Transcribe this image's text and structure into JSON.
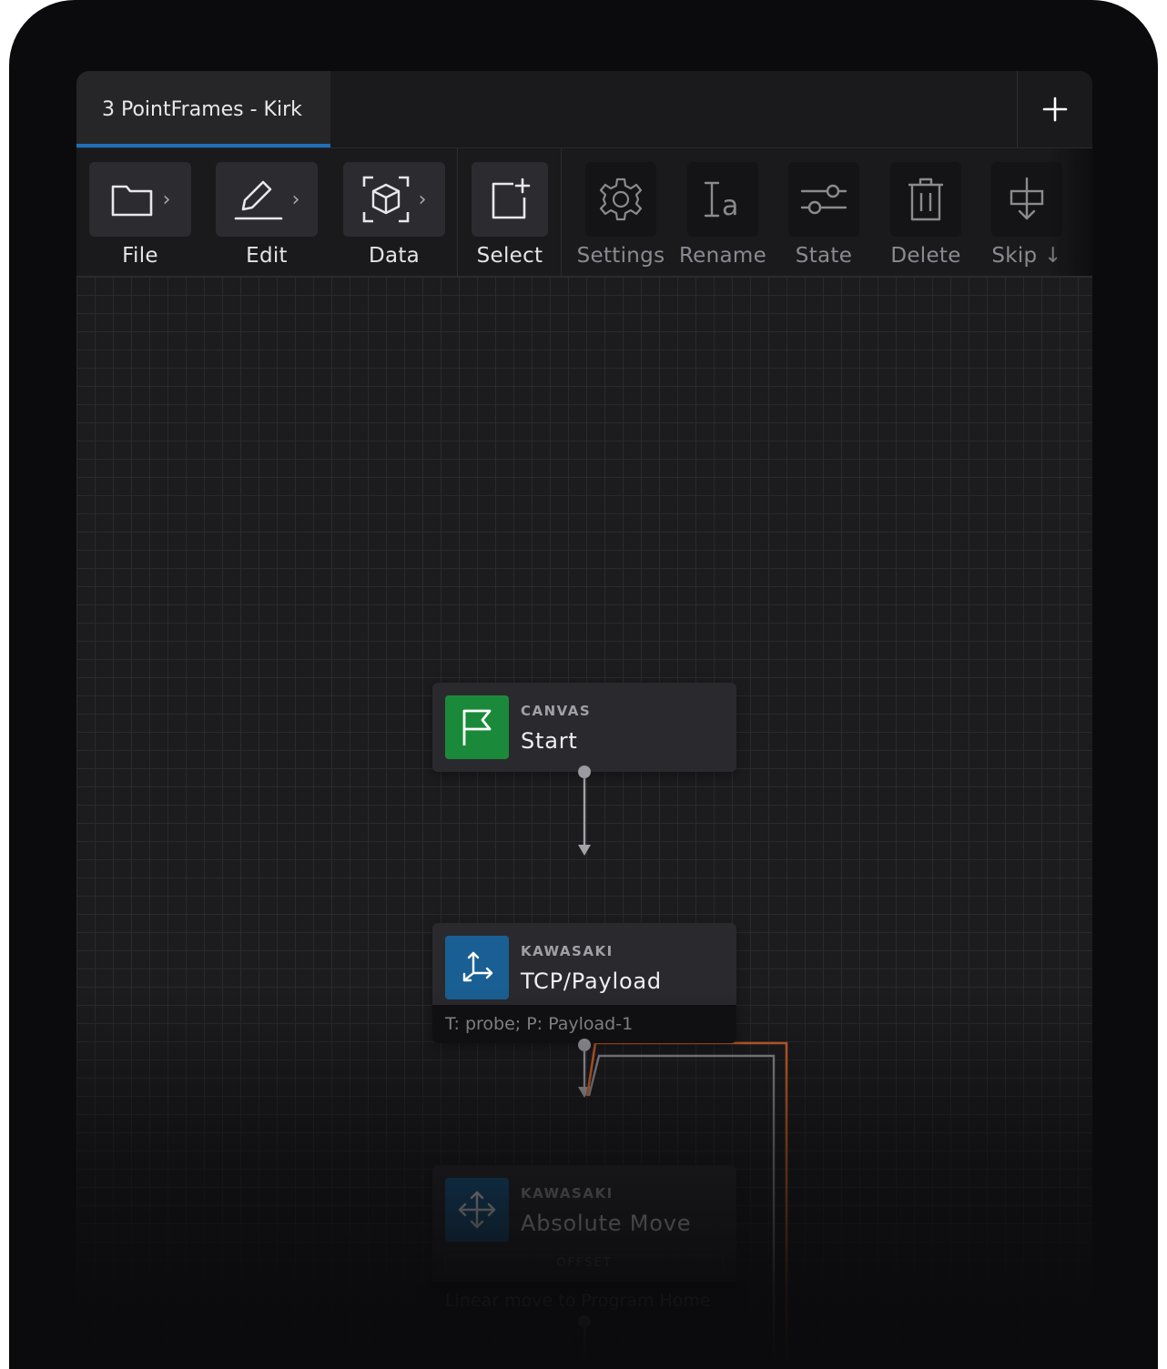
{
  "tabs": {
    "active_label": "3 PointFrames - Kirk",
    "add_icon": "plus-icon"
  },
  "toolbar": {
    "file": {
      "label": "File",
      "icon": "folder-icon"
    },
    "edit": {
      "label": "Edit",
      "icon": "pencil-icon"
    },
    "data": {
      "label": "Data",
      "icon": "cube-icon"
    },
    "select": {
      "label": "Select",
      "icon": "select-add-icon"
    },
    "settings": {
      "label": "Settings",
      "icon": "gear-icon"
    },
    "rename": {
      "label": "Rename",
      "icon": "rename-icon"
    },
    "state": {
      "label": "State",
      "icon": "sliders-icon"
    },
    "delete": {
      "label": "Delete",
      "icon": "trash-icon"
    },
    "skip": {
      "label": "Skip ↓",
      "icon": "skip-icon"
    }
  },
  "nodes": {
    "start": {
      "category": "CANVAS",
      "title": "Start",
      "icon": "flag-icon",
      "color": "#1a8a3a"
    },
    "tcp": {
      "category": "KAWASAKI",
      "title": "TCP/Payload",
      "subtitle": "T: probe; P: Payload-1",
      "icon": "axes-icon",
      "color": "#1a5f93"
    },
    "move": {
      "category": "KAWASAKI",
      "title": "Absolute Move",
      "badge": "OFFSET",
      "subtitle": "Linear move to Program Home",
      "icon": "move-arrows-icon",
      "color": "#1a5f93"
    }
  },
  "colors": {
    "accent": "#1e6fb8",
    "loop_wire": "#d8642a"
  }
}
